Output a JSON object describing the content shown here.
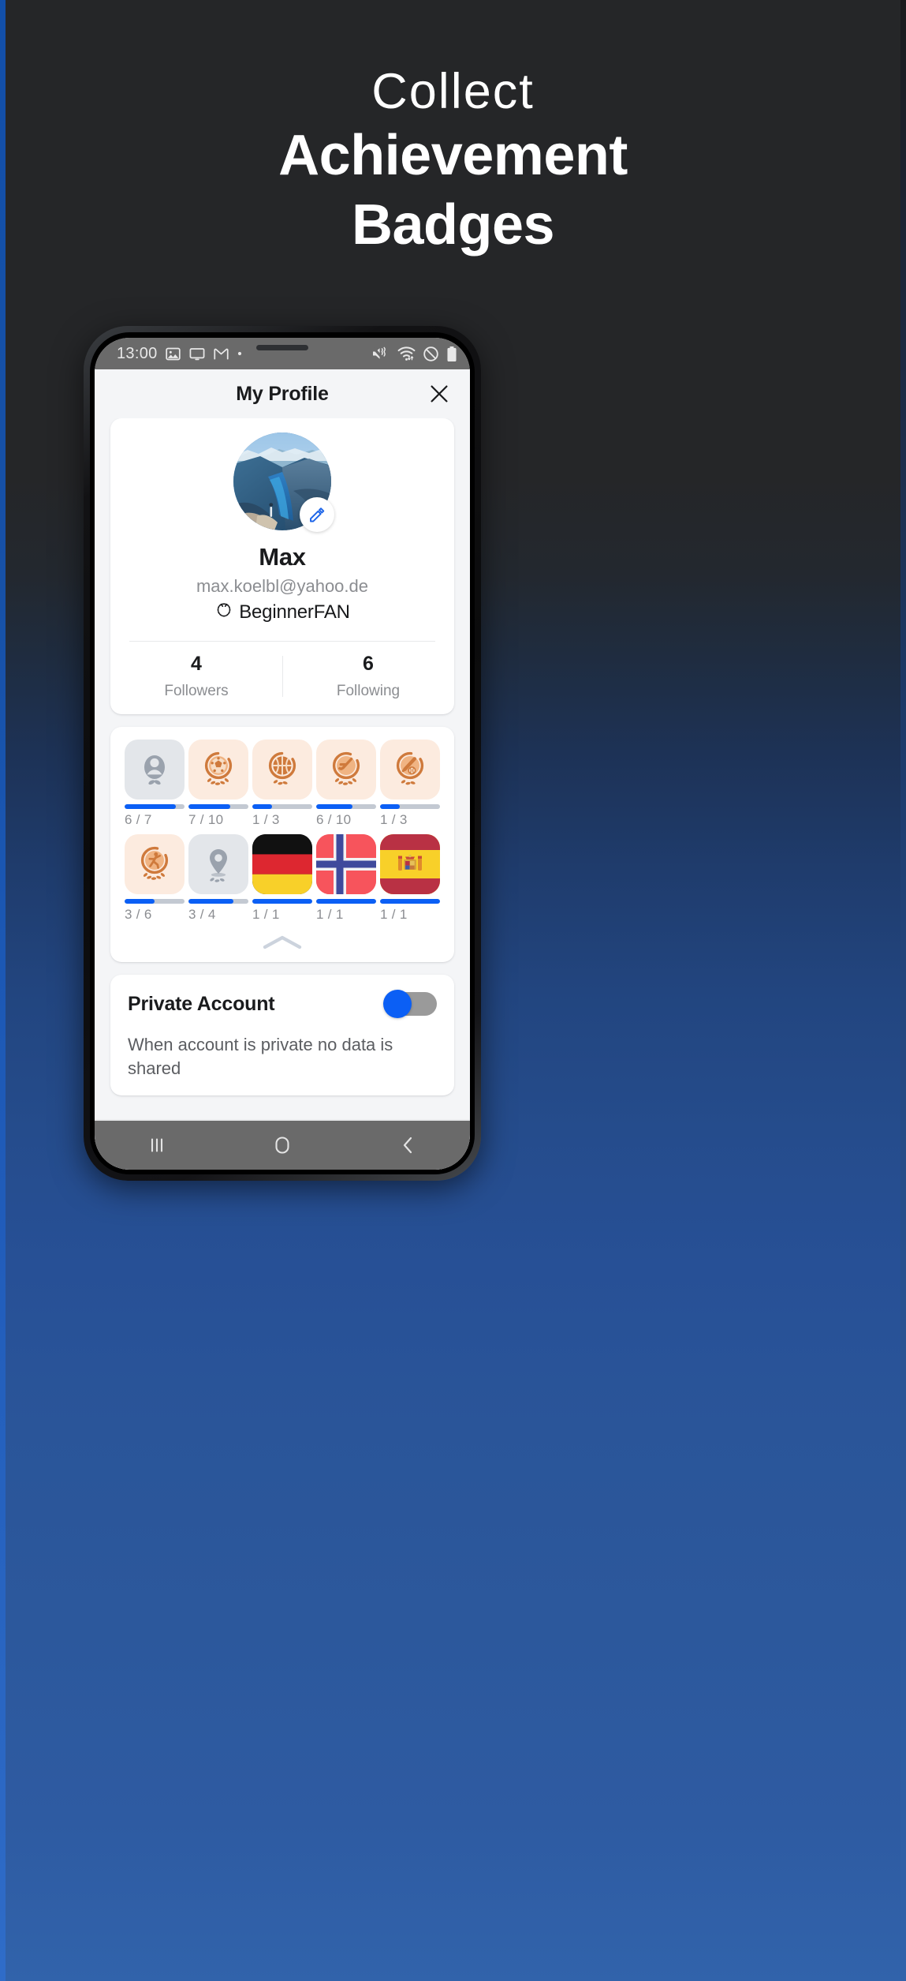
{
  "poster": {
    "headline_line1": "Collect",
    "headline_line2": "Achievement",
    "headline_line3": "Badges",
    "bg_top_color": "#252628",
    "bg_bottom_color": "#3163ab",
    "accent_color": "#0b5ff5"
  },
  "statusbar": {
    "time": "13:00",
    "left_icons": [
      "photo-icon",
      "cast-screen-icon",
      "gmail-icon",
      "dot-icon"
    ],
    "right_icons": [
      "mute-vibrate-icon",
      "wifi-icon",
      "do-not-disturb-icon",
      "battery-icon"
    ],
    "background": "#6a6a6a"
  },
  "app": {
    "title": "My Profile",
    "close_icon": "close-icon",
    "profile": {
      "avatar_alt": "fjord-cliff-photo",
      "edit_icon": "pencil-icon",
      "name": "Max",
      "email": "max.koelbl@yahoo.de",
      "rank_icon": "laurel-wreath-icon",
      "rank_label": "BeginnerFAN",
      "stats": [
        {
          "value": "4",
          "label": "Followers"
        },
        {
          "value": "6",
          "label": "Following"
        }
      ]
    },
    "badges": {
      "collapse_icon": "chevron-up-icon",
      "rows": [
        [
          {
            "icon": "person-badge-icon",
            "tile": "grey",
            "progress_label": "6 / 7",
            "percent": 86
          },
          {
            "icon": "soccer-badge-icon",
            "tile": "orange",
            "progress_label": "7 / 10",
            "percent": 70
          },
          {
            "icon": "basketball-badge-icon",
            "tile": "orange",
            "progress_label": "1 / 3",
            "percent": 33
          },
          {
            "icon": "hockey-badge-icon",
            "tile": "orange",
            "progress_label": "6 / 10",
            "percent": 60
          },
          {
            "icon": "baseball-badge-icon",
            "tile": "orange",
            "progress_label": "1 / 3",
            "percent": 33
          }
        ],
        [
          {
            "icon": "athlete-badge-icon",
            "tile": "orange",
            "progress_label": "3 / 6",
            "percent": 50
          },
          {
            "icon": "location-pin-badge-icon",
            "tile": "grey",
            "progress_label": "3 / 4",
            "percent": 75
          },
          {
            "icon": "flag-germany-icon",
            "tile": "flag",
            "progress_label": "1 / 1",
            "percent": 100
          },
          {
            "icon": "flag-norway-icon",
            "tile": "flag",
            "progress_label": "1 / 1",
            "percent": 100
          },
          {
            "icon": "flag-spain-icon",
            "tile": "flag",
            "progress_label": "1 / 1",
            "percent": 100
          }
        ]
      ]
    },
    "private": {
      "title": "Private Account",
      "toggle_state": "on",
      "description": "When account is private no data is shared"
    }
  },
  "navbar": {
    "recents_icon": "recents-icon",
    "home_icon": "home-icon",
    "back_icon": "back-icon"
  }
}
